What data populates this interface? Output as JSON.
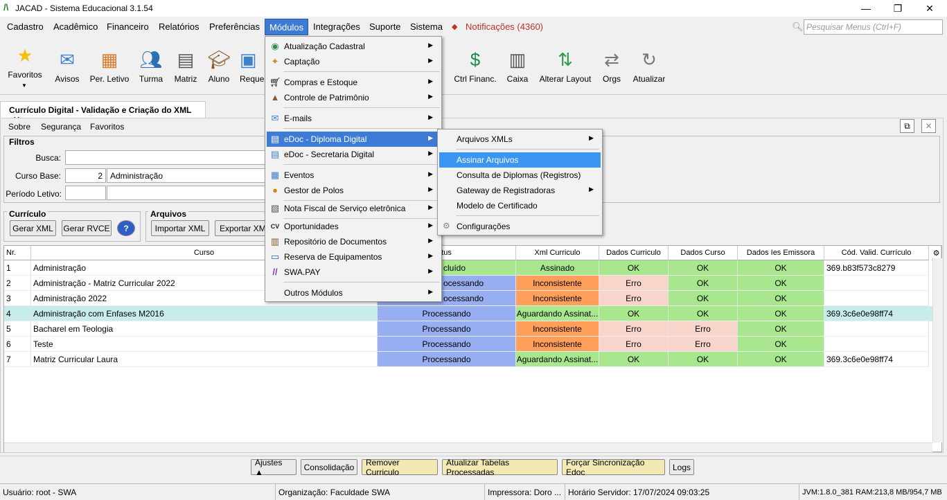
{
  "window": {
    "title": "JACAD - Sistema Educacional 3.1.54",
    "logo": "/\\",
    "minimize": "—",
    "maximize": "❐",
    "close": "✕"
  },
  "menubar": {
    "items": [
      "Cadastro",
      "Acadêmico",
      "Financeiro",
      "Relatórios",
      "Preferências",
      "Módulos",
      "Integrações",
      "Suporte",
      "Sistema"
    ],
    "notifications": "Notificações (4360)",
    "search_placeholder": "Pesquisar Menus (Ctrl+F)"
  },
  "toolbar": {
    "items": [
      {
        "label": "Favoritos",
        "icon": "star-icon"
      },
      {
        "label": "Avisos",
        "icon": "envelope-icon"
      },
      {
        "label": "Per. Letivo",
        "icon": "calendar-icon"
      },
      {
        "label": "Turma",
        "icon": "group-icon"
      },
      {
        "label": "Matriz",
        "icon": "document-person-icon"
      },
      {
        "label": "Aluno",
        "icon": "graduate-icon"
      },
      {
        "label": "Reque",
        "icon": "request-icon"
      },
      {
        "label": "Ctrl Financ.",
        "icon": "money-hand-icon"
      },
      {
        "label": "Caixa",
        "icon": "cash-register-icon"
      },
      {
        "label": "Alterar Layout",
        "icon": "layout-swap-icon"
      },
      {
        "label": "Orgs",
        "icon": "arrows-icon"
      },
      {
        "label": "Atualizar",
        "icon": "refresh-icon"
      }
    ]
  },
  "doc": {
    "tab": "Currículo Digital - Validação e Criação do XML",
    "submenu": [
      "Sobre",
      "Segurança",
      "Favoritos"
    ]
  },
  "filters": {
    "title": "Filtros",
    "busca_label": "Busca:",
    "curso_label": "Curso Base:",
    "curso_code": "2",
    "curso_name": "Administração",
    "periodo_label": "Período Letivo:"
  },
  "curriculo": {
    "title": "Currículo",
    "gerar_xml": "Gerar XML",
    "gerar_rvce": "Gerar RVCE",
    "help": "?"
  },
  "arquivos": {
    "title": "Arquivos",
    "importar": "Importar XML",
    "exportar": "Exportar XM"
  },
  "grid": {
    "headers": [
      "Nr.",
      "Curso",
      "tus",
      "Xml Curriculo",
      "Dados Curriculo",
      "Dados Curso",
      "Dados Ies Emissora",
      "Cód. Valid. Currículo"
    ],
    "rows": [
      {
        "nr": "1",
        "curso": "Administração",
        "status": "cluído",
        "xml": "Assinado",
        "dcurr": "OK",
        "dcurso": "OK",
        "dies": "OK",
        "cod": "369.b83f573c8279"
      },
      {
        "nr": "2",
        "curso": "Administração - Matriz Curricular 2022",
        "status": "ocessando",
        "xml": "Inconsistente",
        "dcurr": "Erro",
        "dcurso": "OK",
        "dies": "OK",
        "cod": ""
      },
      {
        "nr": "3",
        "curso": "Administração 2022",
        "status": "ocessando",
        "xml": "Inconsistente",
        "dcurr": "Erro",
        "dcurso": "OK",
        "dies": "OK",
        "cod": ""
      },
      {
        "nr": "4",
        "curso": "Administração com Enfases M2016",
        "status": "Processando",
        "xml": "Aguardando Assinat...",
        "dcurr": "OK",
        "dcurso": "OK",
        "dies": "OK",
        "cod": "369.3c6e0e98ff74"
      },
      {
        "nr": "5",
        "curso": "Bacharel em Teologia",
        "status": "Processando",
        "xml": "Inconsistente",
        "dcurr": "Erro",
        "dcurso": "Erro",
        "dies": "OK",
        "cod": ""
      },
      {
        "nr": "6",
        "curso": "Teste",
        "status": "Processando",
        "xml": "Inconsistente",
        "dcurr": "Erro",
        "dcurso": "Erro",
        "dies": "OK",
        "cod": ""
      },
      {
        "nr": "7",
        "curso": "Matriz Curricular Laura",
        "status": "Processando",
        "xml": "Aguardando Assinat...",
        "dcurr": "OK",
        "dcurso": "OK",
        "dies": "OK",
        "cod": "369.3c6e0e98ff74"
      }
    ]
  },
  "modules_menu": [
    {
      "label": "Atualização Cadastral",
      "icon": "update-icon"
    },
    {
      "label": "Captação",
      "icon": "capture-icon"
    },
    {
      "label": "Compras e Estoque",
      "icon": "cart-icon"
    },
    {
      "label": "Controle de Patrimônio",
      "icon": "asset-icon"
    },
    {
      "label": "E-mails",
      "icon": "email-icon"
    },
    {
      "label": "eDoc - Diploma Digital",
      "icon": "edoc-icon"
    },
    {
      "label": "eDoc - Secretaria Digital",
      "icon": "edoc-secretaria-icon"
    },
    {
      "label": "Eventos",
      "icon": "events-icon"
    },
    {
      "label": "Gestor de Polos",
      "icon": "polos-icon"
    },
    {
      "label": "Nota Fiscal de Serviço eletrônica",
      "icon": "invoice-icon"
    },
    {
      "label": "Oportunidades",
      "icon": "cv-icon"
    },
    {
      "label": "Repositório de Documentos",
      "icon": "repository-icon"
    },
    {
      "label": "Reserva de Equipamentos",
      "icon": "monitor-icon"
    },
    {
      "label": "SWA.PAY",
      "icon": "pay-icon"
    },
    {
      "label": "Outros Módulos",
      "icon": ""
    }
  ],
  "edoc_menu": [
    {
      "label": "Arquivos XMLs"
    },
    {
      "label": "Assinar Arquivos"
    },
    {
      "label": "Consulta de Diplomas (Registros)"
    },
    {
      "label": "Gateway de Registradoras"
    },
    {
      "label": "Modelo de Certificado"
    },
    {
      "label": "Configurações"
    }
  ],
  "bottom": {
    "ajustes": "Ajustes ▲",
    "consolidacao": "Consolidação",
    "remover": "Remover Curriculo",
    "atualizar": "Atualizar Tabelas Processadas",
    "forcar": "Forçar Sincronização Edoc",
    "logs": "Logs"
  },
  "status": {
    "usuario": "Usuário: root - SWA",
    "org": "Organização: Faculdade SWA",
    "impressora": "Impressora: Doro ...",
    "horario": "Horário Servidor: 17/07/2024 09:03:25",
    "jvm": "JVM:1.8.0_381  RAM:213,8 MB/954,7 MB"
  }
}
